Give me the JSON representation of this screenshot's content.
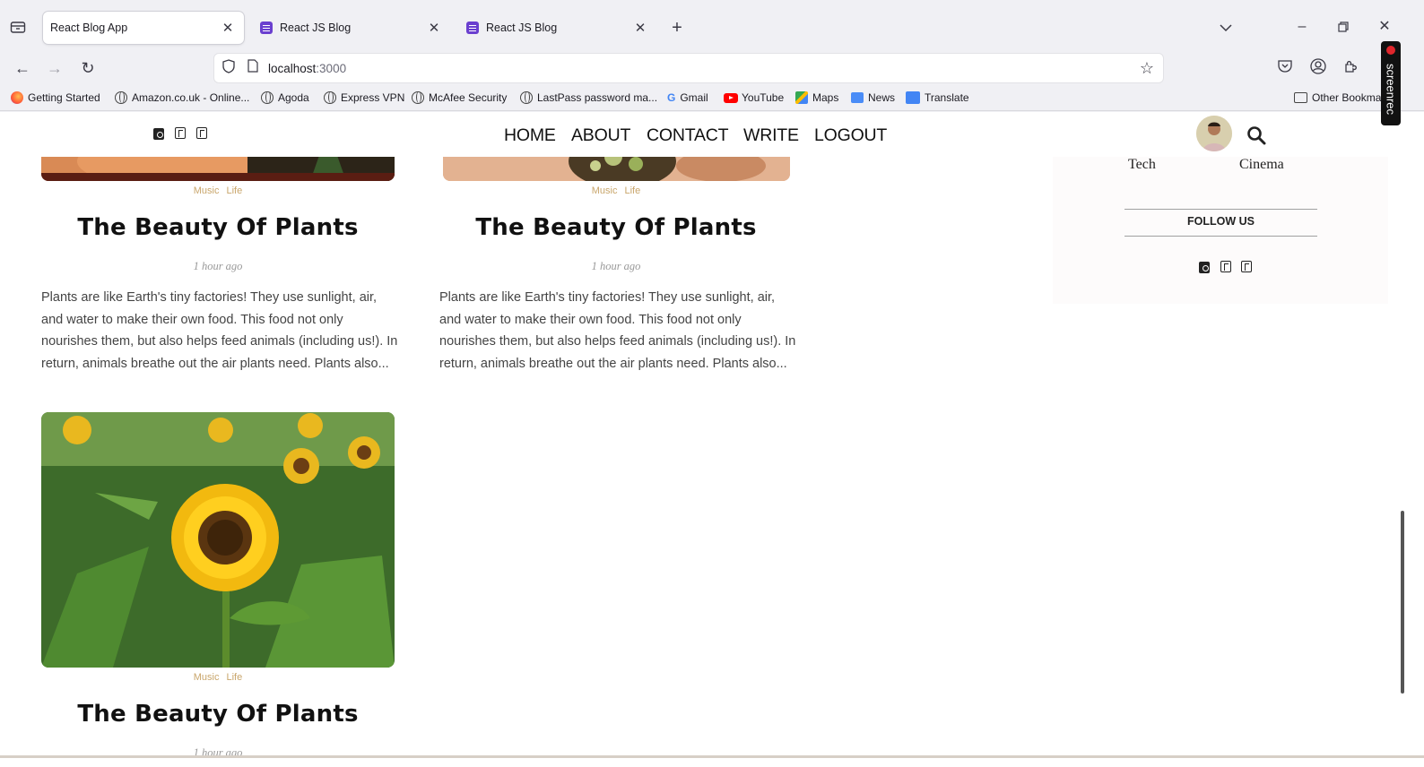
{
  "browser": {
    "tabs": [
      {
        "label": "React Blog App",
        "active": true
      },
      {
        "label": "React JS Blog",
        "active": false
      },
      {
        "label": "React JS Blog",
        "active": false
      }
    ],
    "url_host": "localhost",
    "url_port": ":3000",
    "bookmarks": [
      "Getting Started",
      "Amazon.co.uk - Online...",
      "Agoda",
      "Express VPN",
      "McAfee Security",
      "LastPass password ma...",
      "Gmail",
      "YouTube",
      "Maps",
      "News",
      "Translate"
    ],
    "other_bookmarks": "Other Bookma"
  },
  "nav": {
    "menu": [
      "HOME",
      "ABOUT",
      "CONTACT",
      "WRITE",
      "LOGOUT"
    ]
  },
  "posts": [
    {
      "cats": [
        "Music",
        "Life"
      ],
      "title": "The Beauty Of Plants",
      "date": "1 hour ago",
      "desc": "Plants are like Earth's tiny factories! They use sunlight, air, and water to make their own food. This food not only nourishes them, but also helps feed animals (including us!). In return, animals breathe out the air plants need. Plants also..."
    },
    {
      "cats": [
        "Music",
        "Life"
      ],
      "title": "The Beauty Of Plants",
      "date": "1 hour ago",
      "desc": "Plants are like Earth's tiny factories! They use sunlight, air, and water to make their own food. This food not only nourishes them, but also helps feed animals (including us!). In return, animals breathe out the air plants need. Plants also..."
    },
    {
      "cats": [
        "Music",
        "Life"
      ],
      "title": "The Beauty Of Plants",
      "date": "1 hour ago"
    }
  ],
  "sidebar": {
    "categories": [
      "Tech",
      "Cinema"
    ],
    "follow_title": "FOLLOW US"
  },
  "recorder_label": "screenrec",
  "colors": {
    "accent": "#c9a66b",
    "tab_favicon": "#6a3fcf"
  }
}
